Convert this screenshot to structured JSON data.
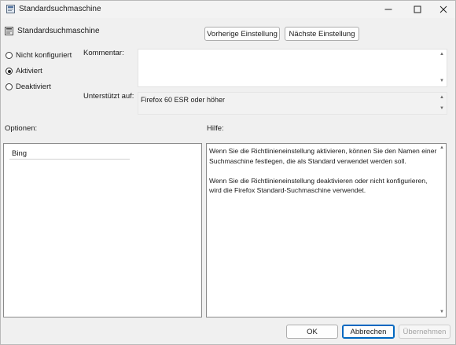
{
  "window": {
    "title": "Standardsuchmaschine",
    "minimize_icon": "minimize-icon",
    "maximize_icon": "maximize-icon",
    "close_icon": "close-icon"
  },
  "header": {
    "policy_name": "Standardsuchmaschine",
    "prev_label": "Vorherige Einstellung",
    "next_label": "Nächste Einstellung"
  },
  "state": {
    "options": [
      {
        "label": "Nicht konfiguriert",
        "checked": false
      },
      {
        "label": "Aktiviert",
        "checked": true
      },
      {
        "label": "Deaktiviert",
        "checked": false
      }
    ]
  },
  "comment": {
    "label": "Kommentar:",
    "value": ""
  },
  "supported": {
    "label": "Unterstützt auf:",
    "value": "Firefox 60 ESR oder höher"
  },
  "options_section": {
    "label": "Optionen:",
    "input_value": "Bing"
  },
  "help_section": {
    "label": "Hilfe:",
    "paragraphs": [
      "Wenn Sie die Richtlinieneinstellung aktivieren, können Sie den Namen einer Suchmaschine festlegen, die als Standard verwendet werden soll.",
      "Wenn Sie die Richtlinieneinstellung deaktivieren oder nicht konfigurieren, wird die Firefox Standard-Suchmaschine verwendet."
    ]
  },
  "footer": {
    "ok_label": "OK",
    "cancel_label": "Abbrechen",
    "apply_label": "Übernehmen"
  }
}
